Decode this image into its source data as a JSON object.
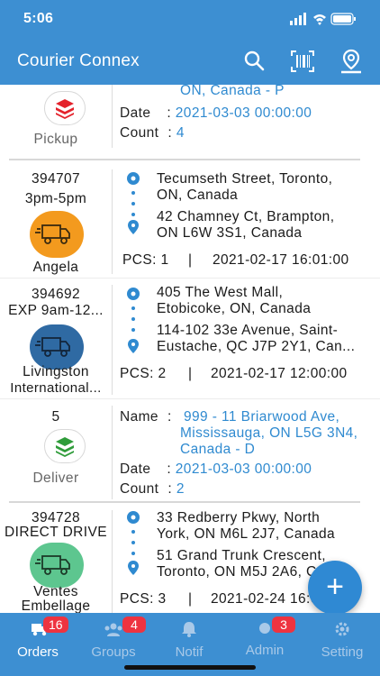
{
  "status_bar": {
    "time": "5:06"
  },
  "app": {
    "title": "Courier Connex"
  },
  "header_icons": [
    "search-icon",
    "barcode-scan-icon",
    "map-pin-icon"
  ],
  "orders": [
    {
      "type": "task",
      "icon": "pickup-stack-icon",
      "icon_color": "#e4222b",
      "label": "Pickup",
      "address_tail": "ON, Canada - P",
      "date_label": "Date",
      "date": "2021-03-03 00:00:00",
      "count_label": "Count",
      "count": "4"
    },
    {
      "type": "delivery",
      "id": "394707",
      "window": "3pm-5pm",
      "driver": "Angela",
      "truck_color": "#f39a1e",
      "pickup_lines": [
        "Tecumseth Street, Toronto,",
        "ON, Canada"
      ],
      "dropoff_lines": [
        "42 Chamney Ct, Brampton,",
        "ON L6W 3S1, Canada"
      ],
      "pcs": "PCS: 1",
      "sep": "|",
      "datetime": "2021-02-17 16:01:00"
    },
    {
      "type": "delivery",
      "id": "394692",
      "window": "EXP 9am-12...",
      "driver_lines": [
        "Livingston",
        "International..."
      ],
      "truck_color": "#2f6aa3",
      "pickup_lines": [
        "405 The West Mall,",
        "Etobicoke, ON, Canada"
      ],
      "dropoff_lines": [
        "114-102 33e Avenue, Saint-",
        "Eustache, QC J7P 2Y1, Can..."
      ],
      "pcs": "PCS: 2",
      "sep": "|",
      "datetime": "2021-02-17 12:00:00"
    },
    {
      "type": "task",
      "count_top": "5",
      "icon": "deliver-stack-icon",
      "icon_color": "#2f9c3a",
      "label": "Deliver",
      "name_label": "Name",
      "name_lines": [
        "999 - 11 Briarwood Ave,",
        "Mississauga, ON L5G 3N4,",
        "Canada - D"
      ],
      "date_label": "Date",
      "date": "2021-03-03 00:00:00",
      "count_label": "Count",
      "count": "2"
    },
    {
      "type": "delivery",
      "id": "394728",
      "window": "DIRECT DRIVE",
      "driver_lines": [
        "Ventes",
        "Embellage"
      ],
      "truck_color": "#5dc68f",
      "pickup_lines": [
        "33 Redberry Pkwy, North",
        "York, ON M6L 2J7, Canada"
      ],
      "dropoff_lines": [
        "51 Grand Trunk Crescent,",
        "Toronto, ON M5J 2A6, Ca..."
      ],
      "pcs": "PCS: 3",
      "sep": "|",
      "datetime": "2021-02-24 16:00:00"
    }
  ],
  "fab": {
    "label": "+"
  },
  "tabs": [
    {
      "label": "Orders",
      "badge": "16",
      "icon": "delivery-truck-icon",
      "active": true
    },
    {
      "label": "Groups",
      "badge": "4",
      "icon": "group-icon"
    },
    {
      "label": "Notif",
      "badge": "",
      "icon": "bell-icon"
    },
    {
      "label": "Admin",
      "badge": "3",
      "icon": "admin-icon"
    },
    {
      "label": "Setting",
      "badge": "",
      "icon": "gear-icon"
    }
  ]
}
